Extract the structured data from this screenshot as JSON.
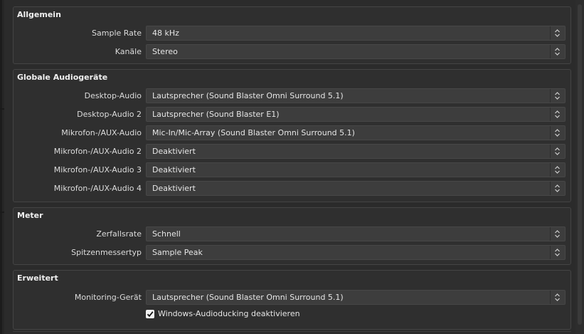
{
  "general": {
    "title": "Allgemein",
    "sample_rate": {
      "label": "Sample Rate",
      "value": "48 kHz"
    },
    "channels": {
      "label": "Kanäle",
      "value": "Stereo"
    }
  },
  "global_devices": {
    "title": "Globale Audiogeräte",
    "rows": [
      {
        "label": "Desktop-Audio",
        "value": "Lautsprecher (Sound Blaster Omni Surround 5.1)"
      },
      {
        "label": "Desktop-Audio 2",
        "value": "Lautsprecher (Sound Blaster E1)"
      },
      {
        "label": "Mikrofon-/AUX-Audio",
        "value": "Mic-In/Mic-Array (Sound Blaster Omni Surround 5.1)"
      },
      {
        "label": "Mikrofon-/AUX-Audio 2",
        "value": "Deaktiviert"
      },
      {
        "label": "Mikrofon-/AUX-Audio 3",
        "value": "Deaktiviert"
      },
      {
        "label": "Mikrofon-/AUX-Audio 4",
        "value": "Deaktiviert"
      }
    ]
  },
  "meter": {
    "title": "Meter",
    "decay": {
      "label": "Zerfallsrate",
      "value": "Schnell"
    },
    "peak_type": {
      "label": "Spitzenmessertyp",
      "value": "Sample Peak"
    }
  },
  "advanced": {
    "title": "Erweitert",
    "monitoring": {
      "label": "Monitoring-Gerät",
      "value": "Lautsprecher (Sound Blaster Omni Surround 5.1)"
    },
    "ducking": {
      "label": "Windows-Audioducking deaktivieren",
      "checked": true
    }
  },
  "icons": {
    "dropdown": "updown-chevron-icon",
    "check": "checkmark-icon"
  }
}
